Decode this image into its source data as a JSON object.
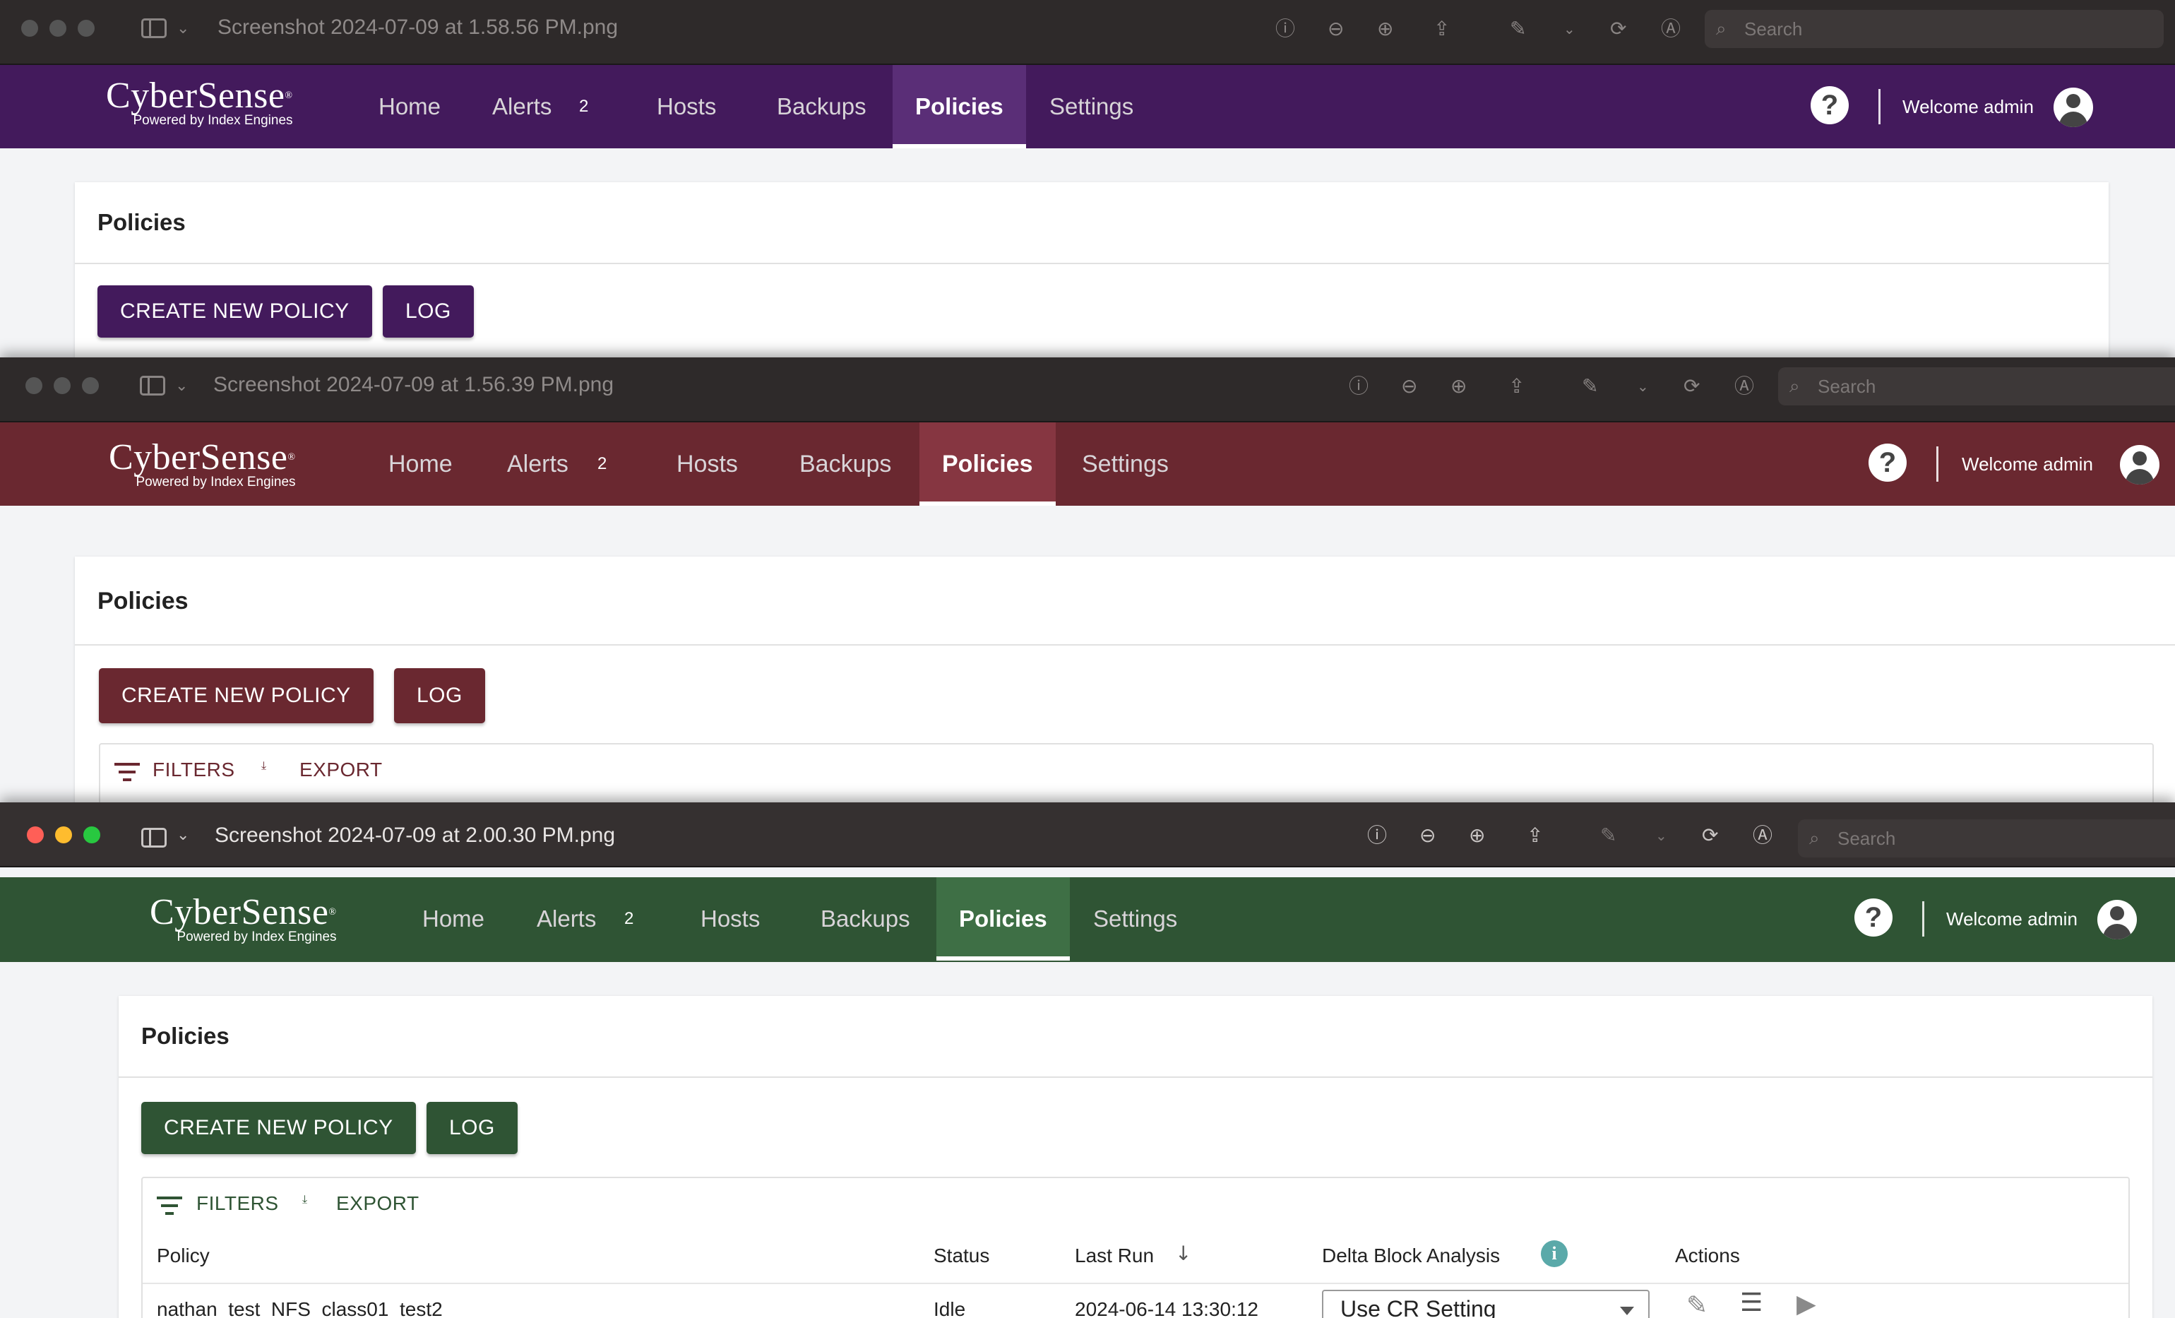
{
  "app": {
    "brand": "CyberSense",
    "brand_mark": "®",
    "tagline": "Powered by Index Engines",
    "nav": [
      "Home",
      "Alerts",
      "Hosts",
      "Backups",
      "Policies",
      "Settings"
    ],
    "alerts_count": "2",
    "welcome": "Welcome admin"
  },
  "viewer": {
    "search_placeholder": "Search"
  },
  "windows": [
    {
      "file_title": "Screenshot 2024-07-09 at 1.58.56 PM.png",
      "theme_color": "#431a5c",
      "active_theme_color": "#5a2e77"
    },
    {
      "file_title": "Screenshot 2024-07-09 at 1.56.39 PM.png",
      "theme_color": "#6a2830",
      "active_theme_color": "#863641"
    },
    {
      "file_title": "Screenshot 2024-07-09 at 2.00.30 PM.png",
      "theme_color": "#2f5434",
      "active_theme_color": "#3e6f45"
    }
  ],
  "page": {
    "title": "Policies",
    "create_button": "CREATE NEW POLICY",
    "log_button": "LOG",
    "filters": "FILTERS",
    "export": "EXPORT"
  },
  "table": {
    "columns": [
      "Policy",
      "Status",
      "Last Run",
      "Delta Block Analysis",
      "Actions"
    ],
    "sort_indicator": "↓",
    "rows": [
      {
        "policy": "nathan_test_NFS_class01_test2",
        "status": "Idle",
        "last_run": "2024-06-14 13:30:12",
        "delta_block": "Use CR Setting"
      }
    ]
  }
}
